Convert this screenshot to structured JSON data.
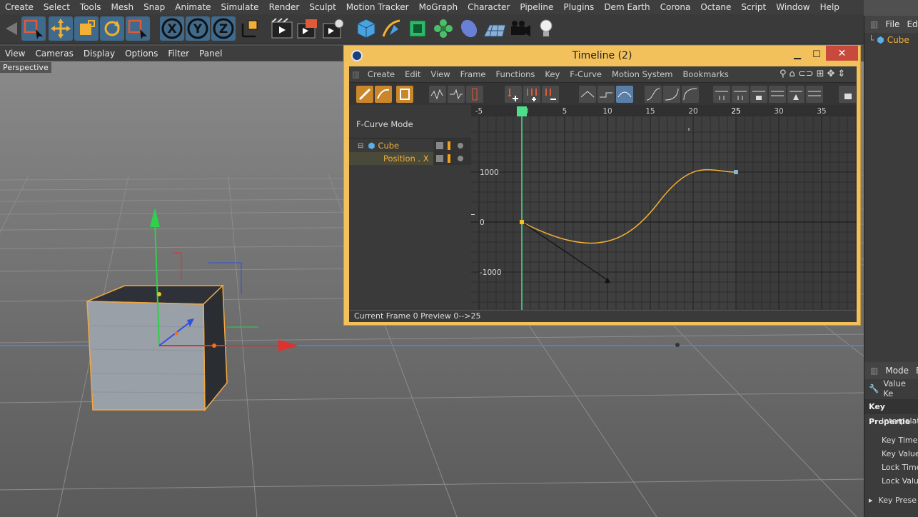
{
  "menubar": [
    "Create",
    "Select",
    "Tools",
    "Mesh",
    "Snap",
    "Animate",
    "Simulate",
    "Render",
    "Sculpt",
    "Motion Tracker",
    "MoGraph",
    "Character",
    "Pipeline",
    "Plugins",
    "Dem Earth",
    "Corona",
    "Octane",
    "Script",
    "Window",
    "Help"
  ],
  "viewport": {
    "menu": [
      "View",
      "Cameras",
      "Display",
      "Options",
      "Filter",
      "Panel"
    ],
    "label": "Perspective"
  },
  "object_manager": {
    "menu": [
      "File",
      "Edi"
    ],
    "items": [
      "Cube"
    ]
  },
  "attribute_manager": {
    "menu": [
      "Mode",
      "E"
    ],
    "mode": "Value Ke",
    "section": "Key Propertie",
    "rows": [
      "Interpolat",
      "Key Time .",
      "Key Value",
      "Lock Time",
      "Lock Valu",
      "Key Prese"
    ]
  },
  "timeline": {
    "title": "Timeline (2)",
    "menu": [
      "Create",
      "Edit",
      "View",
      "Frame",
      "Functions",
      "Key",
      "F-Curve",
      "Motion System",
      "Bookmarks"
    ],
    "mode_label": "F-Curve Mode",
    "tree": {
      "object": "Cube",
      "track": "Position . X"
    },
    "frame_ruler": [
      "-5",
      "0",
      "5",
      "10",
      "15",
      "20",
      "25",
      "30",
      "35"
    ],
    "value_ruler": [
      "1000",
      "0",
      "-1000"
    ],
    "current_frame": 0,
    "status": "Current Frame  0  Preview  0-->25",
    "curve_color": "#f2b035",
    "playhead_color": "#4ddf8a"
  }
}
